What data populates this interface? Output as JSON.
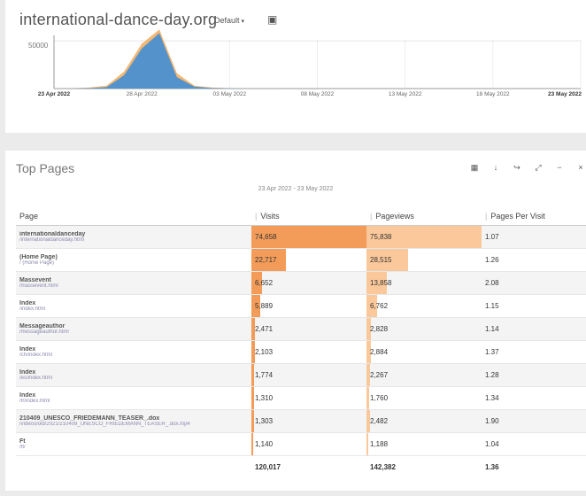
{
  "header": {
    "site": "international-dance-day.org",
    "segment": "Default",
    "caret": "▾",
    "save_icon": "▣"
  },
  "chart_data": {
    "type": "area",
    "x": [
      "23 Apr 2022",
      "24 Apr 2022",
      "25 Apr 2022",
      "26 Apr 2022",
      "27 Apr 2022",
      "28 Apr 2022",
      "29 Apr 2022",
      "30 Apr 2022",
      "01 May 2022",
      "02 May 2022",
      "03 May 2022",
      "04 May 2022",
      "05 May 2022",
      "06 May 2022",
      "07 May 2022",
      "08 May 2022",
      "09 May 2022",
      "10 May 2022",
      "11 May 2022",
      "12 May 2022",
      "13 May 2022",
      "14 May 2022",
      "15 May 2022",
      "16 May 2022",
      "17 May 2022",
      "18 May 2022",
      "19 May 2022",
      "20 May 2022",
      "21 May 2022",
      "22 May 2022",
      "23 May 2022"
    ],
    "series": [
      {
        "values": [
          200,
          400,
          1000,
          3000,
          18000,
          47000,
          62000,
          16000,
          3000,
          1000,
          500,
          300,
          200,
          150,
          120,
          100,
          100,
          100,
          100,
          100,
          100,
          100,
          100,
          100,
          100,
          100,
          100,
          100,
          100,
          100,
          100
        ],
        "color": "#f0b36e"
      },
      {
        "values": [
          100,
          200,
          500,
          1500,
          14000,
          42000,
          58000,
          12000,
          2000,
          600,
          300,
          200,
          100,
          100,
          80,
          60,
          60,
          60,
          60,
          60,
          60,
          60,
          60,
          60,
          60,
          60,
          60,
          60,
          60,
          60,
          60
        ],
        "color": "#4a8fcf"
      }
    ],
    "ytick": "50000",
    "ylim": [
      0,
      65000
    ],
    "xticks": [
      {
        "label": "23 Apr 2022",
        "bold": true,
        "i": 0
      },
      {
        "label": "28 Apr 2022",
        "bold": false,
        "i": 5
      },
      {
        "label": "03 May 2022",
        "bold": false,
        "i": 10
      },
      {
        "label": "08 May 2022",
        "bold": false,
        "i": 15
      },
      {
        "label": "13 May 2022",
        "bold": false,
        "i": 20
      },
      {
        "label": "18 May 2022",
        "bold": false,
        "i": 25
      },
      {
        "label": "23 May 2022",
        "bold": true,
        "i": 30
      }
    ]
  },
  "report": {
    "title": "Top Pages",
    "range": "23 Apr 2022 - 23 May 2022",
    "toolbar": [
      "▦",
      "↓",
      "↪",
      "⤢",
      "−",
      "×"
    ],
    "columns": [
      "Page",
      "Visits",
      "Pageviews",
      "Pages Per Visit"
    ],
    "rows": [
      {
        "name": "internationaldanceday",
        "path": "/internationaldanceday.html",
        "visits": "74,658",
        "pageviews": "75,838",
        "ppv": "1.07",
        "v_frac": 1.0,
        "p_frac": 1.0
      },
      {
        "name": "(Home Page)",
        "path": "/ (Home Page)",
        "visits": "22,717",
        "pageviews": "28,515",
        "ppv": "1.26",
        "v_frac": 0.3,
        "p_frac": 0.36
      },
      {
        "name": "Massevent",
        "path": "/massevent.html",
        "visits": "6,652",
        "pageviews": "13,858",
        "ppv": "2.08",
        "v_frac": 0.09,
        "p_frac": 0.18
      },
      {
        "name": "Index",
        "path": "/index.html",
        "visits": "5,889",
        "pageviews": "6,762",
        "ppv": "1.15",
        "v_frac": 0.08,
        "p_frac": 0.09
      },
      {
        "name": "Messageauthor",
        "path": "/messageauthor.html",
        "visits": "2,471",
        "pageviews": "2,828",
        "ppv": "1.14",
        "v_frac": 0.03,
        "p_frac": 0.04
      },
      {
        "name": "Index",
        "path": "/ch/index.html",
        "visits": "2,103",
        "pageviews": "2,884",
        "ppv": "1.37",
        "v_frac": 0.03,
        "p_frac": 0.04
      },
      {
        "name": "Index",
        "path": "/es/index.html",
        "visits": "1,774",
        "pageviews": "2,267",
        "ppv": "1.28",
        "v_frac": 0.02,
        "p_frac": 0.03
      },
      {
        "name": "Index",
        "path": "/fr/index.html",
        "visits": "1,310",
        "pageviews": "1,760",
        "ppv": "1.34",
        "v_frac": 0.02,
        "p_frac": 0.02
      },
      {
        "name": "210409_UNESCO_FRIEDEMANN_TEASER_.dox",
        "path": "/videos/old/2021/210409_UNESCO_FRIEDEMANN_TEASER_.dox.mp4",
        "visits": "1,303",
        "pageviews": "2,482",
        "ppv": "1.90",
        "v_frac": 0.02,
        "p_frac": 0.03
      },
      {
        "name": "Ft",
        "path": "/ft/",
        "visits": "1,140",
        "pageviews": "1,188",
        "ppv": "1.04",
        "v_frac": 0.015,
        "p_frac": 0.015
      }
    ],
    "totals": {
      "visits": "120,017",
      "pageviews": "142,382",
      "ppv": "1.36"
    }
  }
}
